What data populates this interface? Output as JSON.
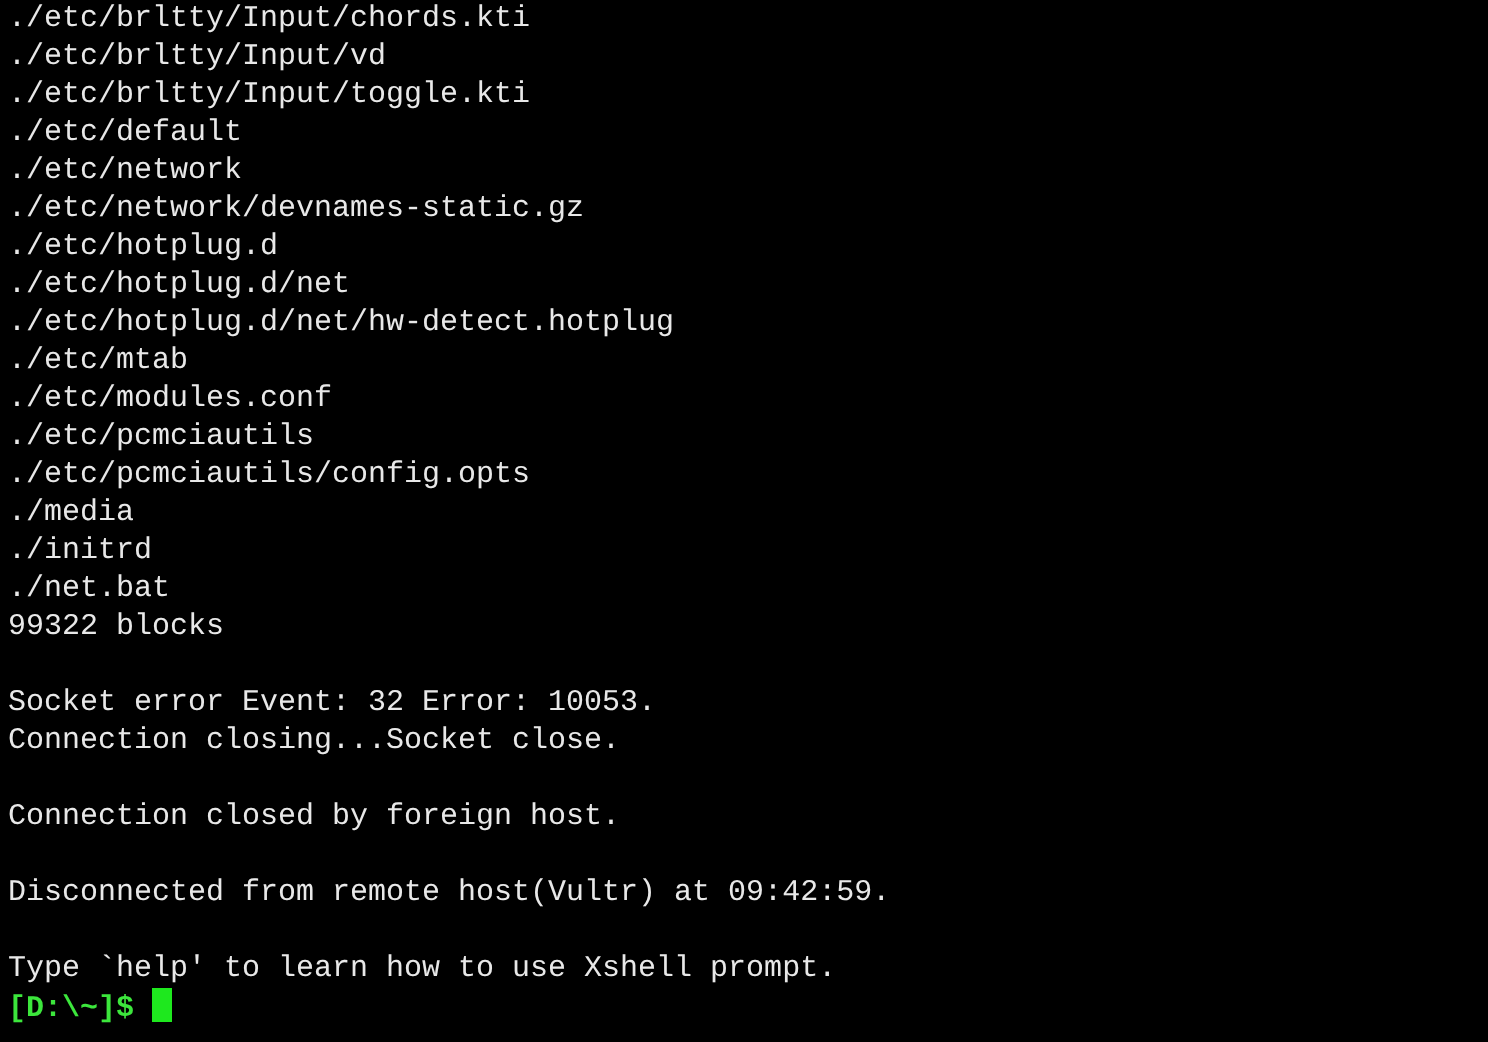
{
  "terminal": {
    "lines": [
      {
        "kind": "output",
        "text": "./etc/brltty/Input/chords.kti"
      },
      {
        "kind": "output",
        "text": "./etc/brltty/Input/vd"
      },
      {
        "kind": "output",
        "text": "./etc/brltty/Input/toggle.kti"
      },
      {
        "kind": "output",
        "text": "./etc/default"
      },
      {
        "kind": "output",
        "text": "./etc/network"
      },
      {
        "kind": "output",
        "text": "./etc/network/devnames-static.gz"
      },
      {
        "kind": "output",
        "text": "./etc/hotplug.d"
      },
      {
        "kind": "output",
        "text": "./etc/hotplug.d/net"
      },
      {
        "kind": "output",
        "text": "./etc/hotplug.d/net/hw-detect.hotplug"
      },
      {
        "kind": "output",
        "text": "./etc/mtab"
      },
      {
        "kind": "output",
        "text": "./etc/modules.conf"
      },
      {
        "kind": "output",
        "text": "./etc/pcmciautils"
      },
      {
        "kind": "output",
        "text": "./etc/pcmciautils/config.opts"
      },
      {
        "kind": "output",
        "text": "./media"
      },
      {
        "kind": "output",
        "text": "./initrd"
      },
      {
        "kind": "output",
        "text": "./net.bat"
      },
      {
        "kind": "output",
        "text": "99322 blocks"
      },
      {
        "kind": "blank"
      },
      {
        "kind": "output",
        "text": "Socket error Event: 32 Error: 10053."
      },
      {
        "kind": "output",
        "text": "Connection closing...Socket close."
      },
      {
        "kind": "blank"
      },
      {
        "kind": "output",
        "text": "Connection closed by foreign host."
      },
      {
        "kind": "blank"
      },
      {
        "kind": "output",
        "text": "Disconnected from remote host(Vultr) at 09:42:59."
      },
      {
        "kind": "blank"
      },
      {
        "kind": "output",
        "text": "Type `help' to learn how to use Xshell prompt."
      }
    ],
    "prompt": {
      "text": "[D:\\~]$",
      "cursor": true
    }
  }
}
